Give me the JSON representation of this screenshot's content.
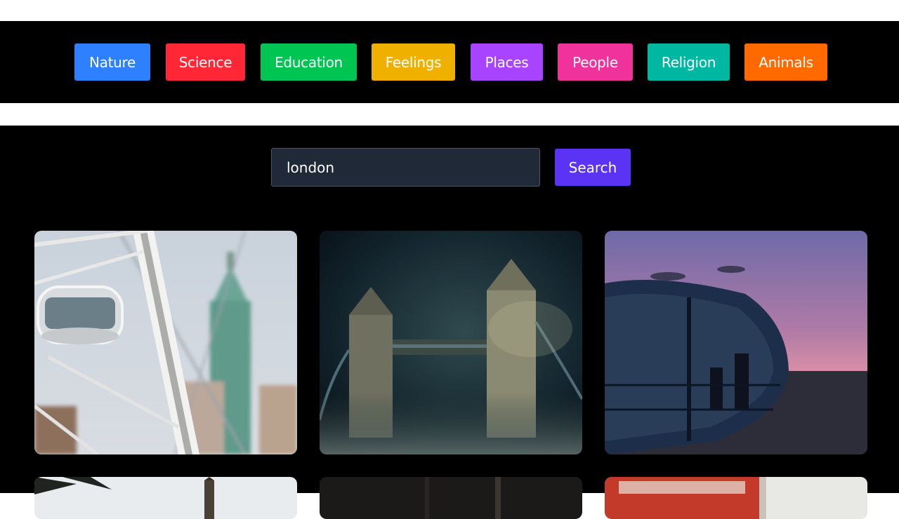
{
  "categories": [
    {
      "label": "Nature",
      "color": "#2f80ff"
    },
    {
      "label": "Science",
      "color": "#ff2636"
    },
    {
      "label": "Education",
      "color": "#00c552"
    },
    {
      "label": "Feelings",
      "color": "#efb000"
    },
    {
      "label": "Places",
      "color": "#a844ff"
    },
    {
      "label": "People",
      "color": "#f0339c"
    },
    {
      "label": "Religion",
      "color": "#00b7a1"
    },
    {
      "label": "Animals",
      "color": "#ff6a00"
    }
  ],
  "search": {
    "value": "london",
    "button_label": "Search",
    "button_color": "#5b33f5"
  },
  "gallery": [
    {
      "subject": "london-eye-capsule"
    },
    {
      "subject": "tower-bridge-night"
    },
    {
      "subject": "london-eye-pod-sunset"
    },
    {
      "subject": "big-ben-trees"
    },
    {
      "subject": "dark-street"
    },
    {
      "subject": "red-bus"
    }
  ]
}
